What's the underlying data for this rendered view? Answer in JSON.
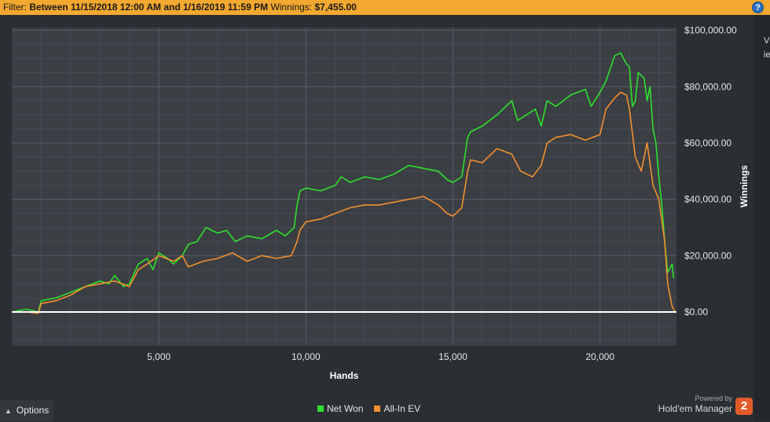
{
  "filter": {
    "label": "Filter:",
    "range_text": "Between 11/15/2018 12:00 AM and 1/16/2019 11:59 PM",
    "winnings_label": "Winnings:",
    "winnings_value": "$7,455.00"
  },
  "help_icon": "question-circle-icon",
  "options": {
    "label": "Options",
    "icon": "caret-up-icon"
  },
  "legend": [
    {
      "label": "Net Won",
      "color": "#2ee02e"
    },
    {
      "label": "All-In EV",
      "color": "#f2902f"
    }
  ],
  "branding": {
    "powered": "Powered by",
    "name": "Hold'em Manager",
    "badge": "2"
  },
  "edge_fragments": [
    "V",
    "ie"
  ],
  "chart_data": {
    "type": "line",
    "title": "",
    "xlabel": "Hands",
    "ylabel": "Winnings",
    "xlim": [
      0,
      22600
    ],
    "ylim": [
      -12000,
      101000
    ],
    "x_ticks": [
      5000,
      10000,
      15000,
      20000
    ],
    "x_tick_labels": [
      "5,000",
      "10,000",
      "15,000",
      "20,000"
    ],
    "y_ticks": [
      0,
      20000,
      40000,
      60000,
      80000,
      100000
    ],
    "y_tick_labels": [
      "$0.00",
      "$20,000.00",
      "$40,000.00",
      "$60,000.00",
      "$80,000.00",
      "$100,000.00"
    ],
    "grid": true,
    "zero_line": true,
    "legend_position": "bottom-center",
    "series": [
      {
        "name": "Net Won",
        "color": "#2ee02e",
        "x": [
          0,
          500,
          900,
          1000,
          1500,
          2000,
          2500,
          3000,
          3300,
          3500,
          3800,
          4000,
          4300,
          4600,
          4800,
          5000,
          5300,
          5500,
          5800,
          6000,
          6300,
          6600,
          7000,
          7300,
          7600,
          8000,
          8500,
          9000,
          9300,
          9600,
          9700,
          9800,
          10000,
          10500,
          11000,
          11200,
          11500,
          12000,
          12500,
          13000,
          13500,
          14000,
          14500,
          14800,
          15000,
          15300,
          15500,
          15600,
          16000,
          16500,
          17000,
          17200,
          17500,
          17800,
          18000,
          18200,
          18500,
          19000,
          19500,
          19700,
          20000,
          20200,
          20500,
          20700,
          20900,
          21000,
          21100,
          21200,
          21300,
          21500,
          21600,
          21700,
          21800,
          21900,
          22000,
          22100,
          22200,
          22300,
          22450,
          22500
        ],
        "y": [
          0,
          1000,
          0,
          4000,
          5000,
          7000,
          9000,
          11000,
          10000,
          13000,
          9000,
          10000,
          17000,
          19000,
          15000,
          21000,
          19000,
          17000,
          20000,
          24000,
          25000,
          30000,
          28000,
          29000,
          25000,
          27000,
          26000,
          29000,
          27000,
          30000,
          38000,
          43000,
          44000,
          43000,
          45000,
          48000,
          46000,
          48000,
          47000,
          49000,
          52000,
          51000,
          50000,
          47000,
          46000,
          48000,
          62000,
          64000,
          66000,
          70000,
          75000,
          68000,
          70000,
          72000,
          66000,
          75000,
          73000,
          77000,
          79000,
          73000,
          78000,
          82000,
          91000,
          92000,
          88000,
          87000,
          73000,
          75000,
          85000,
          83000,
          75000,
          80000,
          65000,
          60000,
          48000,
          38000,
          25000,
          14000,
          17000,
          12000
        ]
      },
      {
        "name": "All-In EV",
        "color": "#f2902f",
        "x": [
          0,
          500,
          900,
          1000,
          1500,
          2000,
          2500,
          3000,
          3500,
          4000,
          4300,
          4600,
          5000,
          5500,
          5800,
          6000,
          6500,
          7000,
          7500,
          8000,
          8500,
          9000,
          9500,
          9700,
          9800,
          10000,
          10500,
          11000,
          11500,
          12000,
          12500,
          13000,
          13500,
          14000,
          14500,
          14800,
          15000,
          15300,
          15500,
          15600,
          16000,
          16500,
          17000,
          17300,
          17700,
          18000,
          18200,
          18500,
          19000,
          19500,
          20000,
          20200,
          20500,
          20700,
          20900,
          21000,
          21200,
          21400,
          21600,
          21800,
          22000,
          22200,
          22300,
          22450,
          22550
        ],
        "y": [
          0,
          0,
          -500,
          3000,
          4000,
          6000,
          9000,
          10000,
          11000,
          9000,
          15000,
          17000,
          20000,
          18000,
          20000,
          16000,
          18000,
          19000,
          21000,
          18000,
          20000,
          19000,
          20000,
          25000,
          29000,
          32000,
          33000,
          35000,
          37000,
          38000,
          38000,
          39000,
          40000,
          41000,
          38000,
          35000,
          34000,
          37000,
          50000,
          54000,
          53000,
          58000,
          56000,
          50000,
          48000,
          52000,
          60000,
          62000,
          63000,
          61000,
          63000,
          72000,
          76000,
          78000,
          77000,
          72000,
          55000,
          50000,
          60000,
          45000,
          40000,
          25000,
          10000,
          2000,
          0
        ]
      }
    ]
  }
}
